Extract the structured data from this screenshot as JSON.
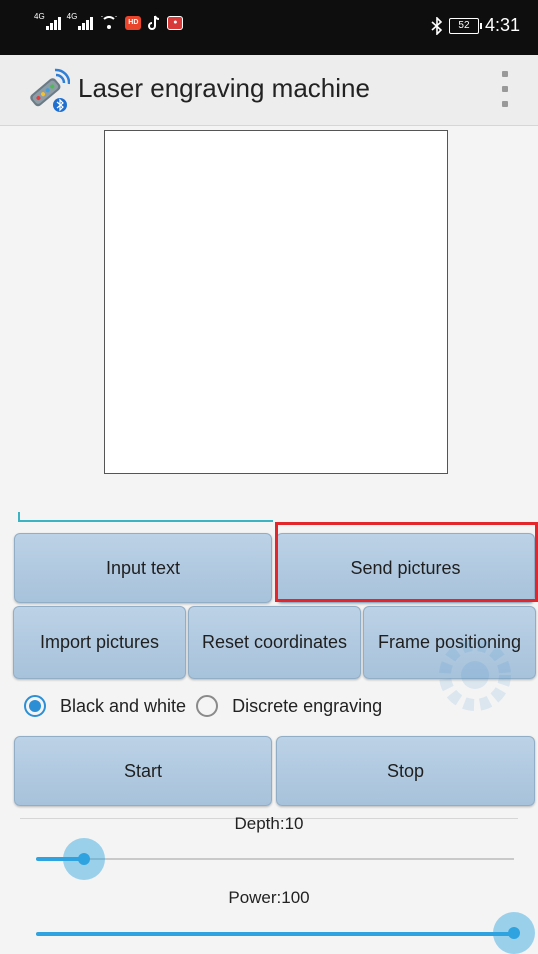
{
  "status_bar": {
    "net1": "4G",
    "net2": "4G",
    "badge_label": "HD",
    "battery": "52",
    "time": "4:31"
  },
  "app_bar": {
    "title": "Laser engraving machine"
  },
  "buttons": {
    "input_text": "Input text",
    "send_pictures": "Send pictures",
    "import_pictures": "Import pictures",
    "reset_coordinates": "Reset coordinates",
    "frame_positioning": "Frame positioning",
    "start": "Start",
    "stop": "Stop"
  },
  "mode": {
    "options": [
      "Black and white",
      "Discrete engraving"
    ],
    "selected": "Black and white"
  },
  "sliders": {
    "depth": {
      "label": "Depth:10",
      "value": 10,
      "max": 100
    },
    "power": {
      "label": "Power:100",
      "value": 100,
      "max": 100
    }
  },
  "colors": {
    "accent": "#2fa3e0",
    "button": "#b2cade",
    "highlight": "#e3262b"
  }
}
